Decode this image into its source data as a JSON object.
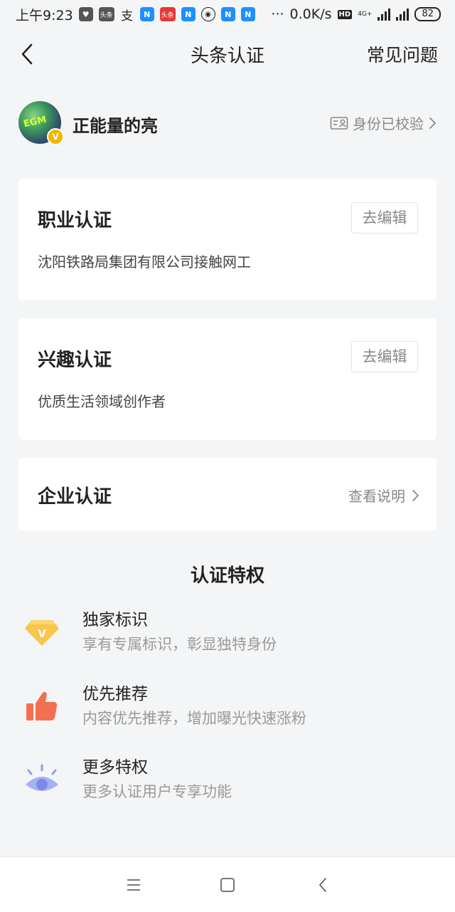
{
  "status_bar": {
    "time": "上午9:23",
    "app_icons": [
      "头条",
      "支",
      "N",
      "头条",
      "N",
      "N",
      "N"
    ],
    "dots": "···",
    "network_speed": "0.0K/s",
    "hd": "HD",
    "network_type": "4G+",
    "battery": "82"
  },
  "nav": {
    "title": "头条认证",
    "faq": "常见问题"
  },
  "profile": {
    "name": "正能量的亮",
    "avatar_text": "EGM",
    "badge": "V",
    "verified_text": "身份已校验"
  },
  "cards": {
    "occupation": {
      "title": "职业认证",
      "desc": "沈阳铁路局集团有限公司接触网工",
      "button": "去编辑"
    },
    "interest": {
      "title": "兴趣认证",
      "desc": "优质生活领域创作者",
      "button": "去编辑"
    },
    "enterprise": {
      "title": "企业认证",
      "link": "查看说明"
    }
  },
  "privileges": {
    "title": "认证特权",
    "items": [
      {
        "name": "独家标识",
        "desc": "享有专属标识，彰显独特身份",
        "icon": "diamond-v-icon",
        "icon_letter": "V",
        "color": "#f7c64a"
      },
      {
        "name": "优先推荐",
        "desc": "内容优先推荐，增加曝光快速涨粉",
        "icon": "thumbs-up-icon",
        "color": "#f36f4f"
      },
      {
        "name": "更多特权",
        "desc": "更多认证用户专享功能",
        "icon": "eye-icon",
        "color": "#8f9cf0"
      }
    ]
  },
  "colors": {
    "background": "#f4f5f6",
    "card": "#ffffff",
    "text_primary": "#222222",
    "text_secondary": "#888888"
  }
}
